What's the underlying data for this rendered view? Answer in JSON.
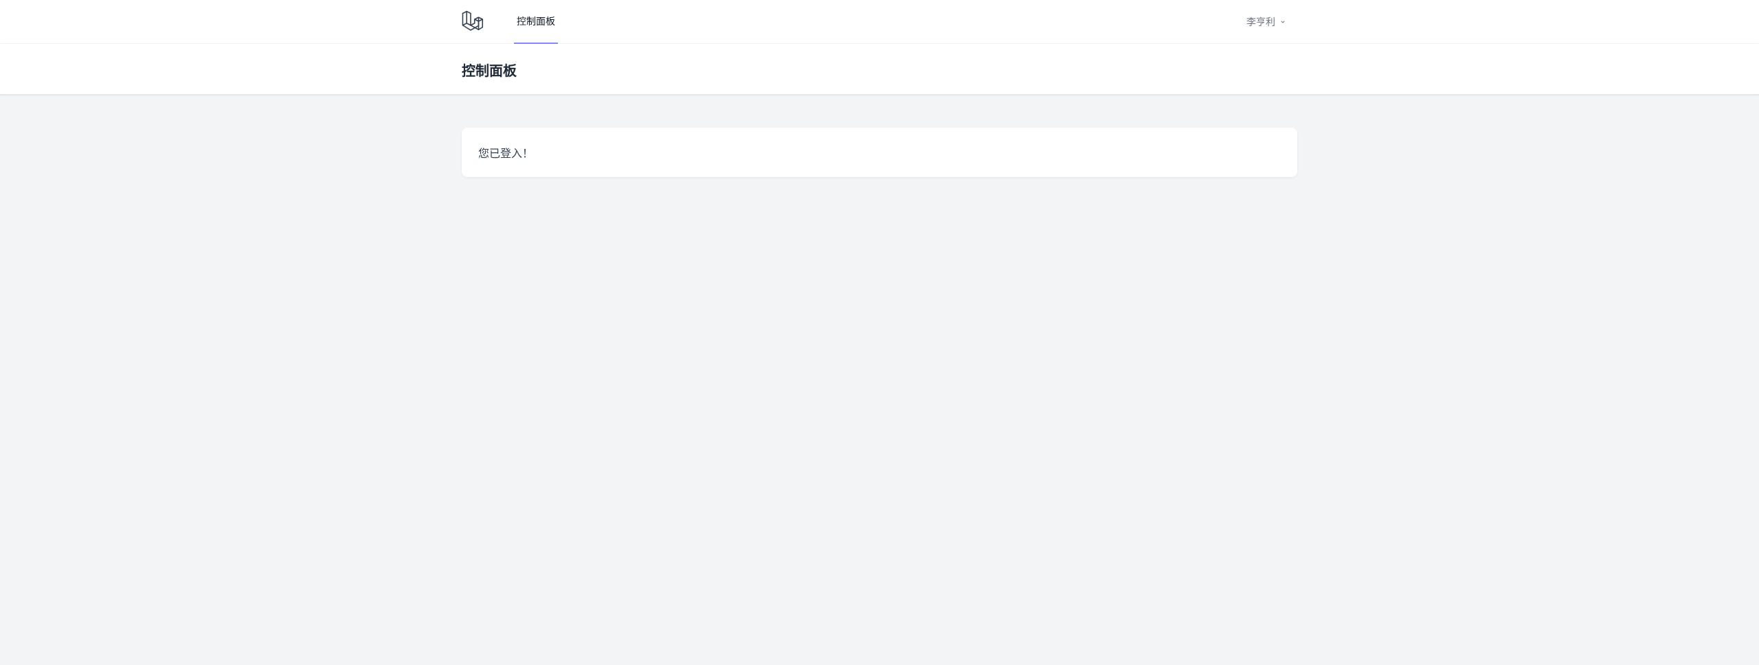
{
  "nav": {
    "links": [
      {
        "label": "控制面板",
        "active": true
      }
    ],
    "user_name": "李亨利",
    "accent_color": "#818cf8"
  },
  "header": {
    "title": "控制面板"
  },
  "main": {
    "message": "您已登入！"
  },
  "icons": {
    "logo": "laravel-logo-icon",
    "dropdown": "chevron-down-icon"
  }
}
